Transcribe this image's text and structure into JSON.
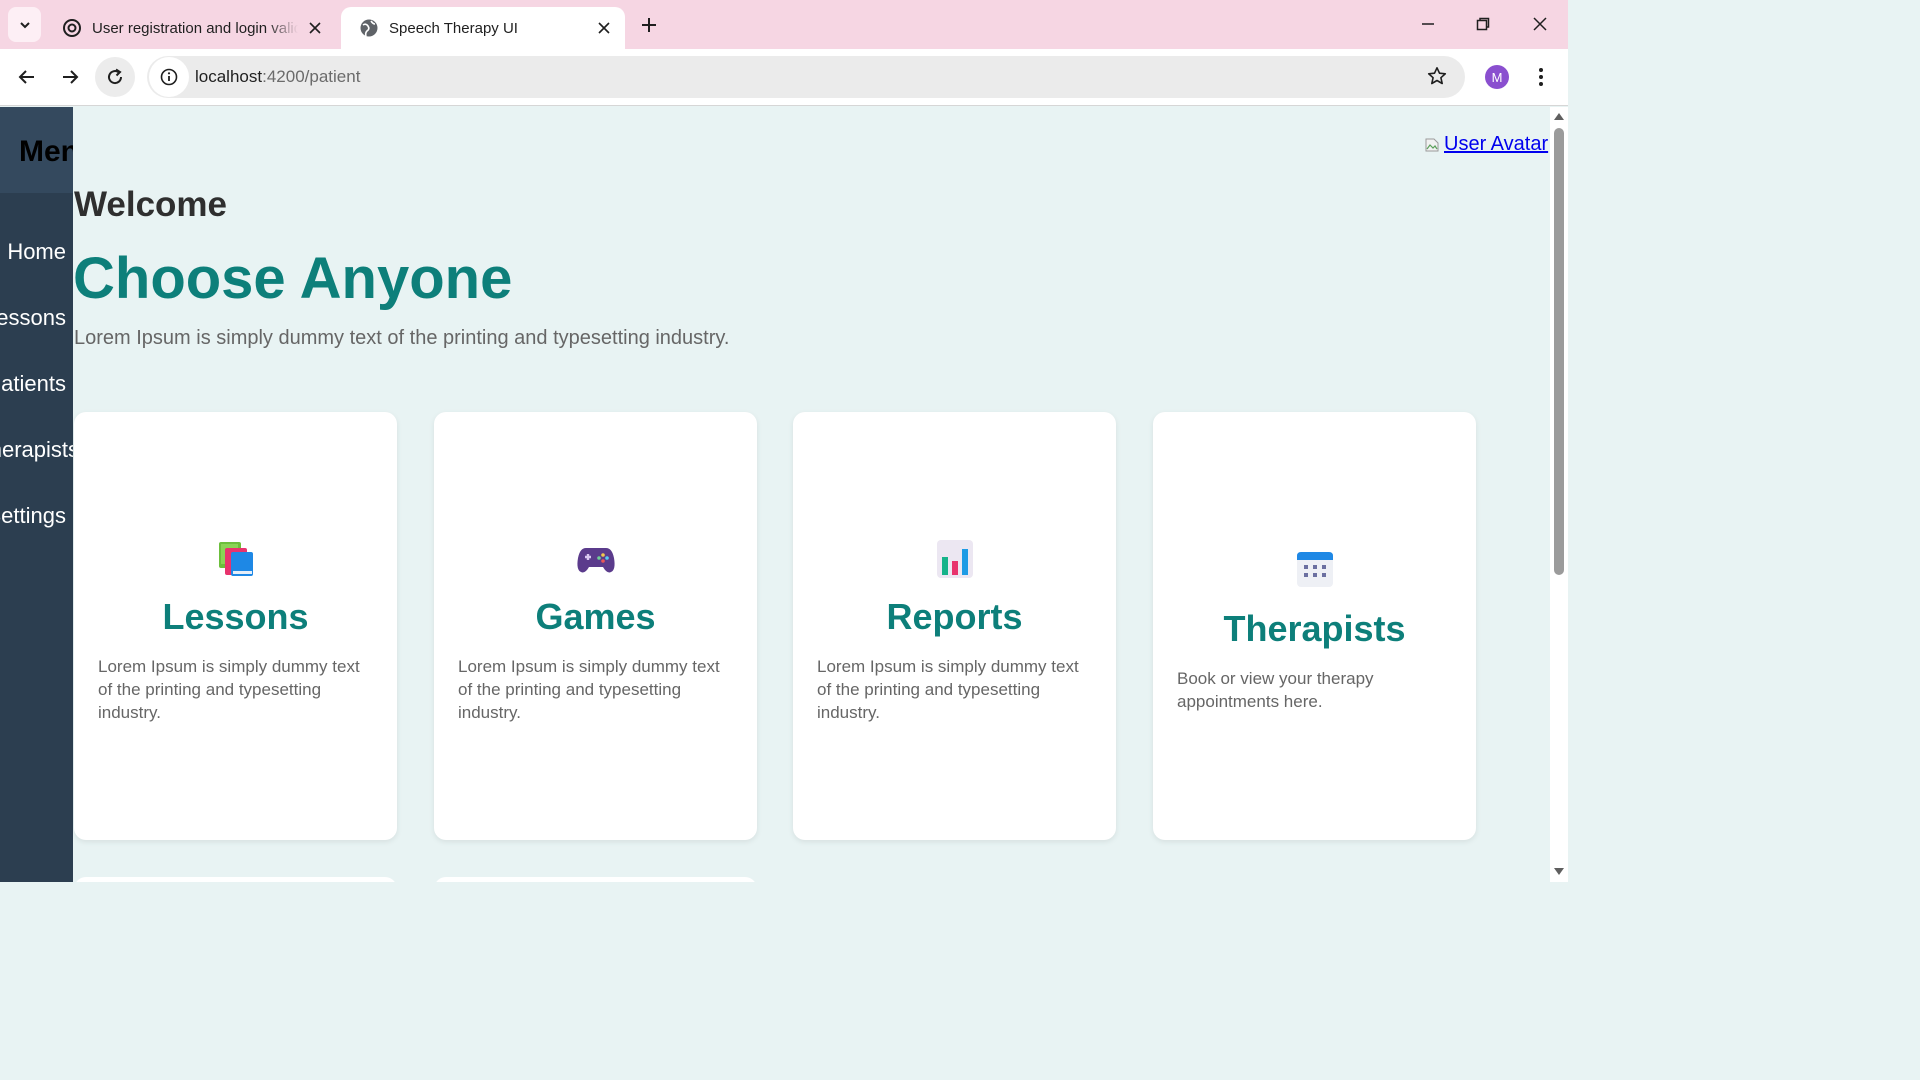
{
  "browser": {
    "tabs": [
      {
        "title": "User registration and login validation",
        "active": false,
        "icon": "openai-icon"
      },
      {
        "title": "Speech Therapy UI",
        "active": true,
        "icon": "globe-icon"
      }
    ],
    "url_host": "localhost",
    "url_path": ":4200/patient",
    "profile_initial": "M"
  },
  "sidebar": {
    "title": "Menu",
    "items": [
      {
        "label": "Home"
      },
      {
        "label": "Lessons"
      },
      {
        "label": "Patients"
      },
      {
        "label": "Therapists"
      },
      {
        "label": "Settings"
      }
    ]
  },
  "header": {
    "avatar_alt": "User Avatar"
  },
  "main": {
    "welcome": "Welcome",
    "heading": "Choose Anyone",
    "subtitle": "Lorem Ipsum is simply dummy text of the printing and typesetting industry."
  },
  "cards": [
    {
      "title": "Lessons",
      "text": "Lorem Ipsum is simply dummy text of the printing and typesetting industry.",
      "icon": "books-icon"
    },
    {
      "title": "Games",
      "text": "Lorem Ipsum is simply dummy text of the printing and typesetting industry.",
      "icon": "game-controller-icon"
    },
    {
      "title": "Reports",
      "text": "Lorem Ipsum is simply dummy text of the printing and typesetting industry.",
      "icon": "bar-chart-icon"
    },
    {
      "title": "Therapists",
      "text": "Book or view your therapy appointments here.",
      "icon": "calendar-icon"
    }
  ],
  "colors": {
    "accent": "#0d7f7a",
    "sidebar": "#2c3e50",
    "page_background": "#e8f3f3",
    "tabstrip": "#f6d6e3"
  }
}
